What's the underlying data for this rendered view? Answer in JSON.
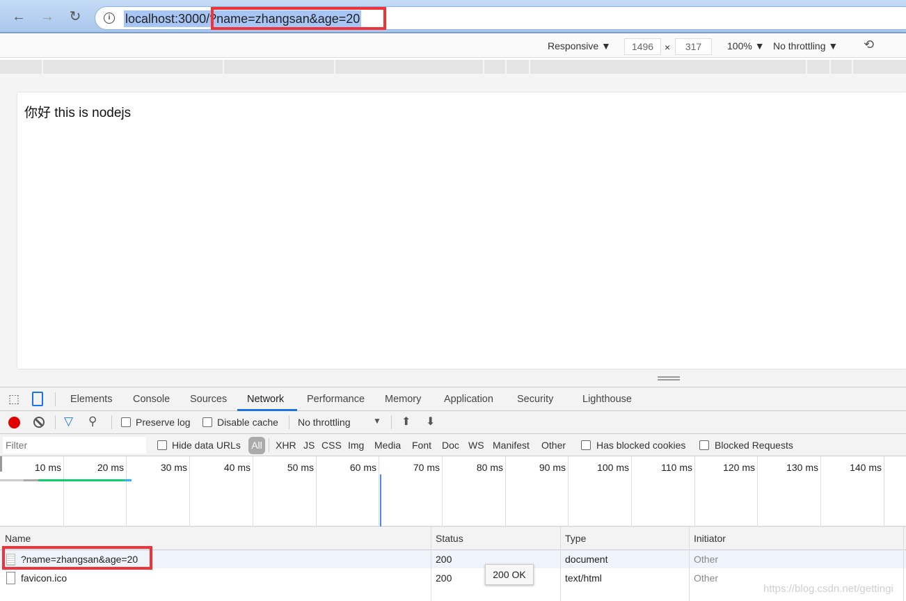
{
  "browser": {
    "url_host": "localhost:3000/",
    "url_query": "?name=zhangsan&age=20",
    "icons": [
      "back-arrow-icon",
      "forward-arrow-icon",
      "reload-icon",
      "info-icon"
    ]
  },
  "device_toolbar": {
    "mode": "Responsive ▼",
    "width": "1496",
    "times": "×",
    "height": "317",
    "zoom": "100% ▼",
    "throttling": "No throttling ▼"
  },
  "page": {
    "text": "你好 this is nodejs"
  },
  "devtools": {
    "tabs": [
      "Elements",
      "Console",
      "Sources",
      "Network",
      "Performance",
      "Memory",
      "Application",
      "Security",
      "Lighthouse"
    ],
    "active_tab": "Network",
    "toolbar": {
      "preserve_log": "Preserve log",
      "disable_cache": "Disable cache",
      "throttling": "No throttling",
      "throttling_arrow": "▼"
    },
    "filter": {
      "placeholder": "Filter",
      "hide_data_urls": "Hide data URLs",
      "types": [
        "All",
        "XHR",
        "JS",
        "CSS",
        "Img",
        "Media",
        "Font",
        "Doc",
        "WS",
        "Manifest",
        "Other"
      ],
      "has_blocked_cookies": "Has blocked cookies",
      "blocked_requests": "Blocked Requests"
    },
    "timeline": {
      "ticks": [
        "10 ms",
        "20 ms",
        "30 ms",
        "40 ms",
        "50 ms",
        "60 ms",
        "70 ms",
        "80 ms",
        "90 ms",
        "100 ms",
        "110 ms",
        "120 ms",
        "130 ms",
        "140 ms"
      ]
    },
    "table": {
      "columns": [
        "Name",
        "Status",
        "Type",
        "Initiator"
      ],
      "rows": [
        [
          "?name=zhangsan&age=20",
          "200",
          "document",
          "Other"
        ],
        [
          "favicon.ico",
          "200",
          "text/html",
          "Other"
        ]
      ]
    },
    "tooltip": "200 OK"
  },
  "watermark": "https://blog.csdn.net/gettingi",
  "colors": {
    "accent": "#1a73e8",
    "highlight": "#f03339",
    "record": "#e00000"
  }
}
